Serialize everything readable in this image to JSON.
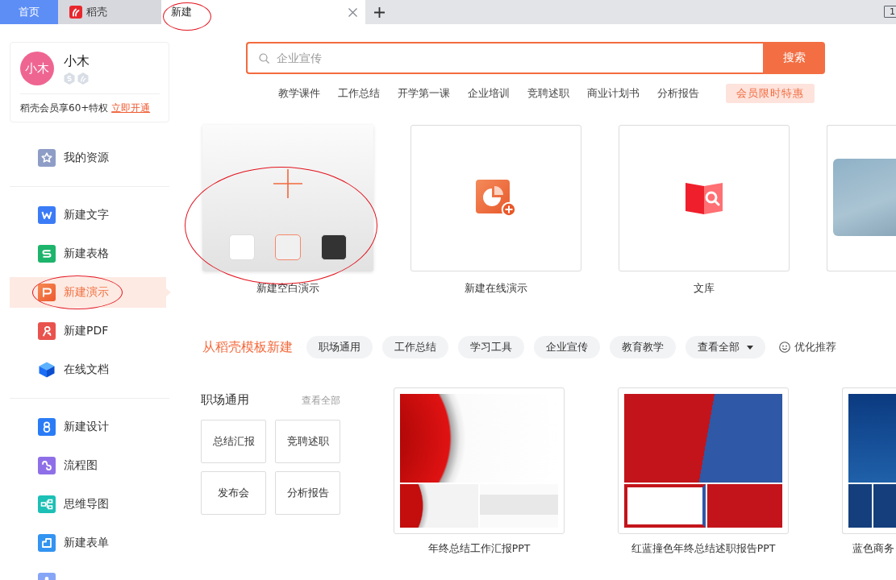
{
  "tab_bar": {
    "tabs": [
      {
        "kind": "home",
        "label": "首页",
        "selected": false,
        "annotated": false
      },
      {
        "kind": "app",
        "label": "稻壳",
        "selected": false,
        "annotated": false
      },
      {
        "kind": "doc",
        "label": "新建",
        "selected": true,
        "annotated": true
      }
    ],
    "window_count": "1"
  },
  "profile": {
    "avatar_text": "小木",
    "name": "小木",
    "promo_text": "稻壳会员享60+特权",
    "promo_link": "立即开通"
  },
  "sidebar": {
    "groups": [
      {
        "items": [
          {
            "label": "我的资源",
            "selected": false,
            "annotated": false
          }
        ]
      },
      {
        "items": [
          {
            "label": "新建文字",
            "selected": false,
            "annotated": false
          },
          {
            "label": "新建表格",
            "selected": false,
            "annotated": false
          },
          {
            "label": "新建演示",
            "selected": true,
            "annotated": true
          },
          {
            "label": "新建PDF",
            "selected": false,
            "annotated": false
          },
          {
            "label": "在线文档",
            "selected": false,
            "annotated": false
          }
        ]
      },
      {
        "items": [
          {
            "label": "新建设计",
            "selected": false,
            "annotated": false
          },
          {
            "label": "流程图",
            "selected": false,
            "annotated": false
          },
          {
            "label": "思维导图",
            "selected": false,
            "annotated": false
          },
          {
            "label": "新建表单",
            "selected": false,
            "annotated": false
          },
          {
            "selected": false,
            "annotated": false
          }
        ]
      }
    ]
  },
  "search": {
    "placeholder": "企业宣传",
    "button": "搜索"
  },
  "hot_searches": [
    "教学课件",
    "工作总结",
    "开学第一课",
    "企业培训",
    "竞聘述职",
    "商业计划书",
    "分析报告"
  ],
  "promo_badge": "会员限时特惠",
  "create_cards": [
    {
      "kind": "blank",
      "label": "新建空白演示",
      "annotated": true,
      "swatches": [
        {
          "color": "#ffffff",
          "selected": false
        },
        {
          "color": "#f0f0f0",
          "selected": true
        },
        {
          "color": "#333333",
          "selected": false
        }
      ]
    },
    {
      "kind": "online",
      "label": "新建在线演示",
      "annotated": false
    },
    {
      "kind": "library",
      "label": "文库",
      "annotated": false
    },
    {
      "kind": "template",
      "annotated": false
    }
  ],
  "template_section": {
    "title": "从稻壳模板新建",
    "chips": [
      {
        "kind": "filter",
        "label": "职场通用"
      },
      {
        "kind": "filter",
        "label": "工作总结"
      },
      {
        "kind": "filter",
        "label": "学习工具"
      },
      {
        "kind": "filter",
        "label": "企业宣传"
      },
      {
        "kind": "filter",
        "label": "教育教学"
      },
      {
        "kind": "dropdown",
        "label": "查看全部"
      }
    ],
    "recommend": "优化推荐"
  },
  "category_panel": {
    "title": "职场通用",
    "more": "查看全部",
    "tiles": [
      "总结汇报",
      "竞聘述职",
      "发布会",
      "分析报告"
    ]
  },
  "templates": [
    {
      "title": "年终总结工作汇报PPT"
    },
    {
      "title": "红蓝撞色年终总结述职报告PPT"
    },
    {
      "title": "蓝色商务"
    }
  ]
}
